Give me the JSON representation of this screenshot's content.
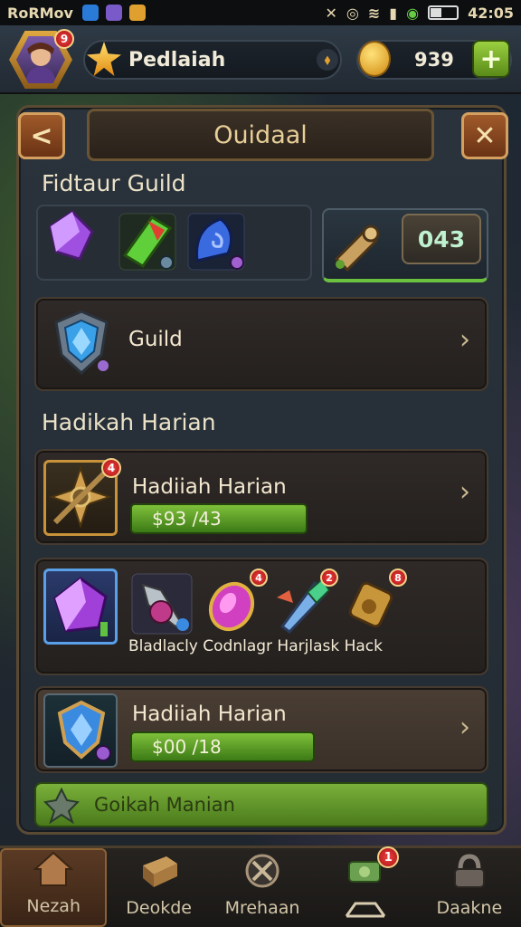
{
  "status_bar": {
    "app_name": "RoRMov",
    "time": "42:05"
  },
  "top_bar": {
    "player_name": "Pedlaiah",
    "avatar_badge": "9",
    "coins": "939",
    "add_label": "+"
  },
  "panel": {
    "title": "Ouidaal",
    "back_label": "<",
    "close_label": "✕",
    "section1_title": "Fidtaur Guild",
    "counter": "043",
    "guild_label": "Guild",
    "section2_title": "Hadikah Harian",
    "reward1": {
      "title": "Hadiiah Harian",
      "badge": "4",
      "progress": "$93 /43"
    },
    "items_row": {
      "labels": "Bladlacly Codnlagr Harjlask Hack",
      "badges": [
        "4",
        "2",
        "8"
      ]
    },
    "reward2": {
      "title": "Hadiiah Harian",
      "progress": "$00 /18"
    },
    "claim_label": "Goikah Manian"
  },
  "nav": {
    "items": [
      {
        "label": "Nezah"
      },
      {
        "label": "Deokde"
      },
      {
        "label": "Mrehaan"
      },
      {
        "label": ""
      },
      {
        "label": "Daakne"
      }
    ],
    "badge": "1"
  },
  "colors": {
    "accent": "#e0a840",
    "green": "#7ec03a",
    "panel": "#2a333c"
  }
}
